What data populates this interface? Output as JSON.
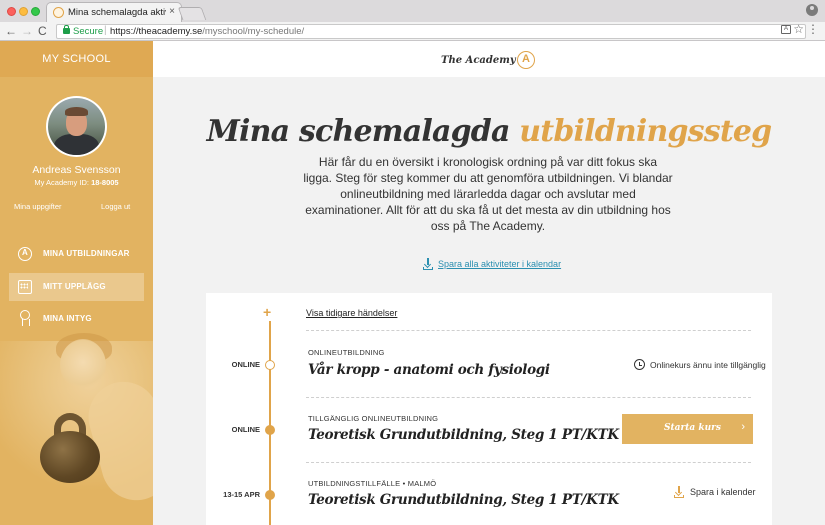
{
  "browser": {
    "tab_title": "Mina schemalagda aktiviteter",
    "tab_close": "×",
    "secure_label": "Secure",
    "url_host": "https://theacademy.se",
    "url_path": "/myschool/my-schedule/",
    "back": "←",
    "forward": "→",
    "reload": "C",
    "star": "☆",
    "menu": "⋮"
  },
  "sidebar": {
    "header": "MY SCHOOL",
    "user_name": "Andreas Svensson",
    "user_id_label": "My Academy ID:",
    "user_id": "18-8005",
    "link_details": "Mina uppgifter",
    "link_logout": "Logga ut",
    "nav": [
      {
        "label": "MINA UTBILDNINGAR",
        "icon": "academy-badge-icon"
      },
      {
        "label": "MITT UPPLÄGG",
        "icon": "calendar-icon",
        "active": true
      },
      {
        "label": "MINA INTYG",
        "icon": "certificate-icon"
      }
    ]
  },
  "header": {
    "logo_text": "The Academy",
    "logo_letter": "A"
  },
  "hero": {
    "title_plain": "Mina schemalagda",
    "title_accent": "utbildningssteg",
    "description": "Här får du en översikt i kronologisk ordning på var ditt fokus ska ligga. Steg för steg kommer du att genomföra utbildningen. Vi blandar onlineutbildning med lärarledda dagar och avslutar med examinationer. Allt för att du ska få ut det mesta av din utbildning hos oss på The Academy.",
    "save_all_link": "Spara alla aktiviteter i kalendar"
  },
  "timeline": {
    "plus": "+",
    "show_earlier": "Visa tidigare händelser",
    "events": [
      {
        "date": "ONLINE",
        "type": "ONLINEUTBILDNING",
        "title": "Vår kropp - anatomi och fysiologi",
        "status": "Onlinekurs ännu inte tillgänglig",
        "dot": "hollow"
      },
      {
        "date": "ONLINE",
        "type": "TILLGÄNGLIG ONLINEUTBILDNING",
        "title": "Teoretisk Grundutbildning, Steg 1 PT/KTK",
        "action": "Starta kurs",
        "action_chevron": "›",
        "dot": "filled"
      },
      {
        "date": "13-15 APR",
        "type": "UTBILDNINGSTILLFÄLLE • MALMÖ",
        "title": "Teoretisk Grundutbildning, Steg 1 PT/KTK",
        "action": "Spara i kalender",
        "dot": "filled"
      }
    ]
  },
  "colors": {
    "accent": "#e0a44a",
    "sidebar": "#e2b361",
    "link": "#2b8fb0"
  }
}
